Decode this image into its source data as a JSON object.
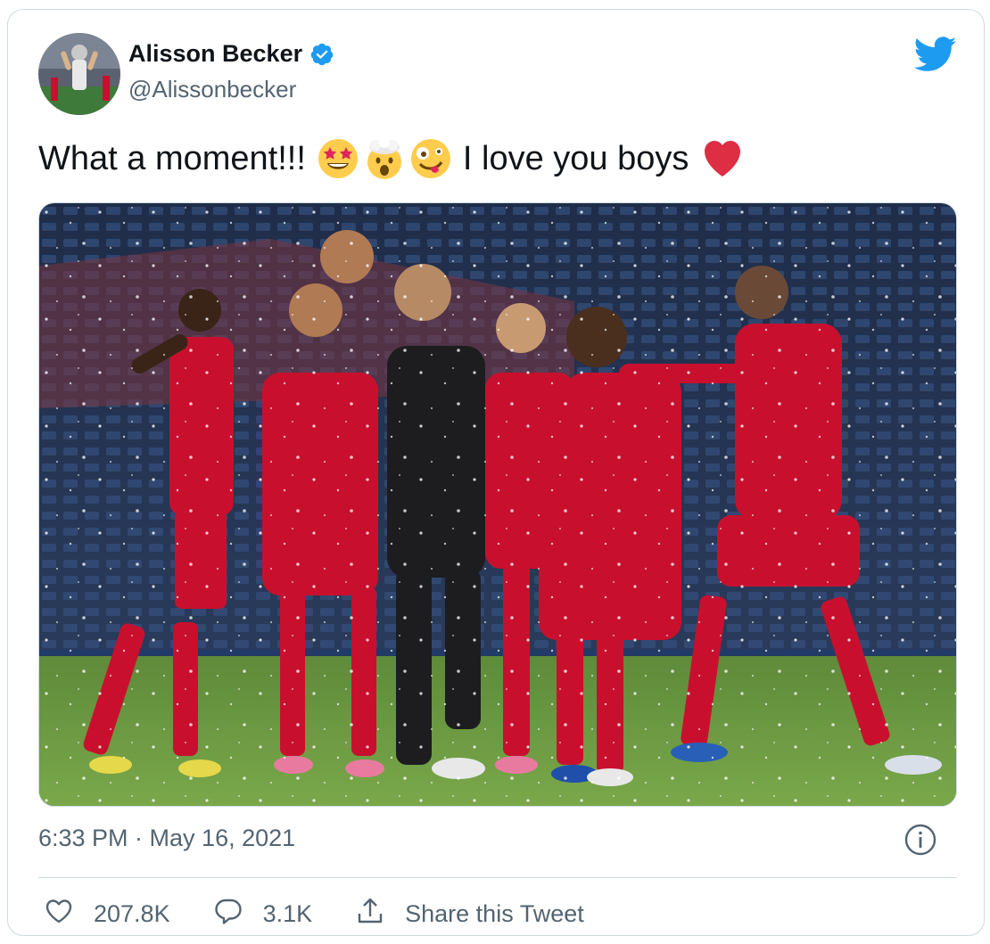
{
  "author": {
    "display_name": "Alisson Becker",
    "handle": "@Alissonbecker",
    "verified": true
  },
  "tweet": {
    "text_before": "What a moment!!!",
    "emojis": [
      "star-struck-emoji",
      "exploding-head-emoji",
      "zany-face-emoji"
    ],
    "text_after": "I love you boys",
    "trailing_emoji": "red-heart-emoji",
    "media": "photo of Liverpool players celebrating with goalkeeper in the rain"
  },
  "meta": {
    "timestamp": "6:33 PM · May 16, 2021"
  },
  "actions": {
    "likes": "207.8K",
    "replies": "3.1K",
    "share_label": "Share this Tweet"
  },
  "colors": {
    "twitter_blue": "#1d9bf0",
    "text_primary": "#0f1419",
    "text_secondary": "#536471",
    "border": "#cfd9de",
    "heart_red": "#e0245e"
  }
}
